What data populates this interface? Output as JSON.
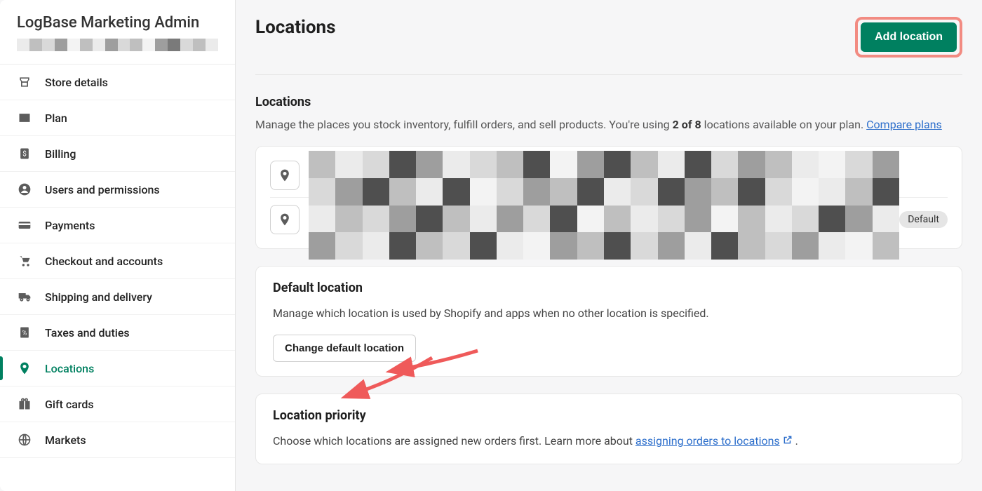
{
  "sidebar": {
    "storeName": "LogBase Marketing Admin",
    "items": [
      {
        "label": "Store details",
        "icon": "store-icon"
      },
      {
        "label": "Plan",
        "icon": "card-icon"
      },
      {
        "label": "Billing",
        "icon": "dollar-icon"
      },
      {
        "label": "Users and permissions",
        "icon": "user-icon"
      },
      {
        "label": "Payments",
        "icon": "creditcard-icon"
      },
      {
        "label": "Checkout and accounts",
        "icon": "cart-icon"
      },
      {
        "label": "Shipping and delivery",
        "icon": "truck-icon"
      },
      {
        "label": "Taxes and duties",
        "icon": "percent-icon"
      },
      {
        "label": "Locations",
        "icon": "pin-icon",
        "active": true
      },
      {
        "label": "Gift cards",
        "icon": "gift-icon"
      },
      {
        "label": "Markets",
        "icon": "globe-icon"
      }
    ]
  },
  "page": {
    "title": "Locations",
    "addButton": "Add location"
  },
  "locationsSection": {
    "title": "Locations",
    "descPrefix": "Manage the places you stock inventory, fulfill orders, and sell products. You're using ",
    "usage": "2 of 8",
    "descMid": " locations available on your plan. ",
    "compareLink": "Compare plans",
    "defaultBadge": "Default"
  },
  "defaultCard": {
    "title": "Default location",
    "desc": "Manage which location is used by Shopify and apps when no other location is specified.",
    "button": "Change default location"
  },
  "priorityCard": {
    "title": "Location priority",
    "descPrefix": "Choose which locations are assigned new orders first. Learn more about ",
    "link": "assigning orders to locations",
    "descSuffix": " ."
  }
}
